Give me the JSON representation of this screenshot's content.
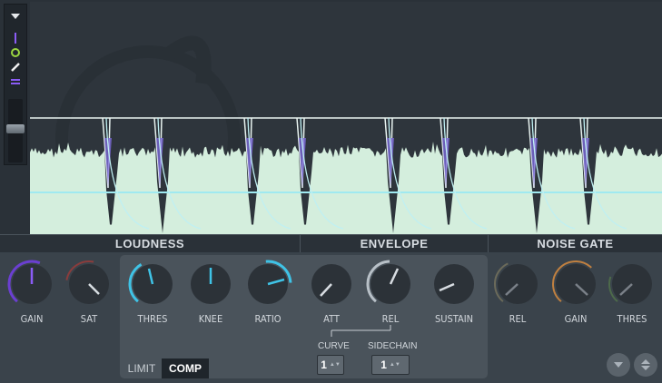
{
  "sections": {
    "loudness": "LOUDNESS",
    "envelope": "ENVELOPE",
    "noise_gate": "NOISE GATE"
  },
  "knobs": {
    "gain": "GAIN",
    "sat": "SAT",
    "thres": "THRES",
    "knee": "KNEE",
    "ratio": "RATIO",
    "att": "ATT",
    "rel": "REL",
    "sustain": "SUSTAIN",
    "gate_rel": "REL",
    "gate_gain": "GAIN",
    "gate_thres": "THRES"
  },
  "spinners": {
    "curve_label": "CURVE",
    "curve_value": "1",
    "sidechain_label": "SIDECHAIN",
    "sidechain_value": "1"
  },
  "modes": {
    "limit": "LIMIT",
    "comp": "COMP",
    "active": "COMP"
  },
  "colors": {
    "waveform_fill": "#d4eedd",
    "graph_bg": "#2e353c",
    "panel_bg": "#4a535b",
    "accent_cyan": "#3fc3e6",
    "accent_purple": "#8b5cf6",
    "accent_orange": "#c08040"
  },
  "icons": {
    "toolbar": [
      "dropdown-arrow-icon",
      "line-icon",
      "circle-icon",
      "pencil-icon",
      "double-line-icon"
    ],
    "bottom_buttons": [
      "chevron-down-icon",
      "updown-arrows-icon"
    ]
  }
}
